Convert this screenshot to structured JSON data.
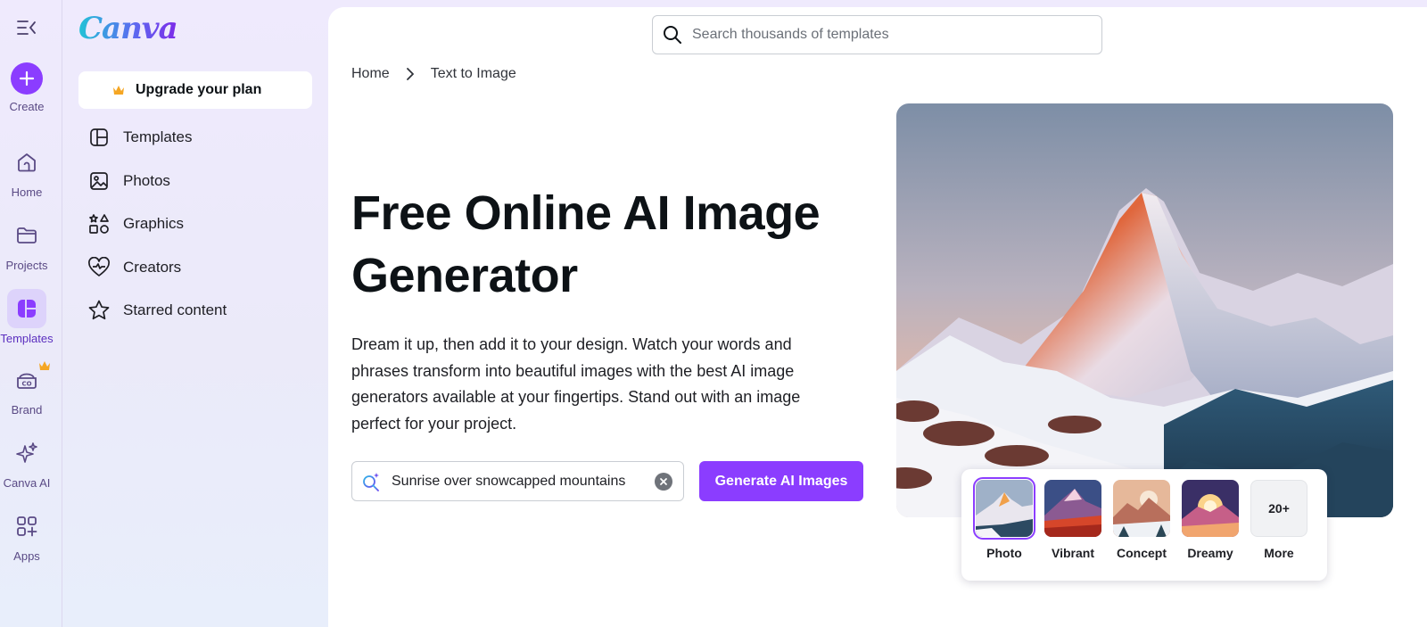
{
  "rail": {
    "create_label": "Create",
    "items": [
      {
        "label": "Home",
        "icon": "home-icon"
      },
      {
        "label": "Projects",
        "icon": "folder-icon"
      },
      {
        "label": "Templates",
        "icon": "templates-icon"
      },
      {
        "label": "Brand",
        "icon": "brand-icon"
      },
      {
        "label": "Canva AI",
        "icon": "sparkle-icon"
      },
      {
        "label": "Apps",
        "icon": "apps-icon"
      }
    ],
    "active": "Templates"
  },
  "panel": {
    "logo": "Canva",
    "upgrade_label": "Upgrade your plan",
    "items": [
      {
        "label": "Templates",
        "icon": "templates-outline-icon"
      },
      {
        "label": "Photos",
        "icon": "photo-icon"
      },
      {
        "label": "Graphics",
        "icon": "shapes-icon"
      },
      {
        "label": "Creators",
        "icon": "heart-icon"
      },
      {
        "label": "Starred content",
        "icon": "star-icon"
      }
    ]
  },
  "search": {
    "placeholder": "Search thousands of templates"
  },
  "breadcrumb": {
    "home": "Home",
    "current": "Text to Image"
  },
  "hero": {
    "title_line1": "Free Online AI Image",
    "title_line2": "Generator",
    "description": "Dream it up, then add it to your design. Watch your words and phrases transform into beautiful images with the best AI image generators available at your fingertips. Stand out with an image perfect for your project."
  },
  "prompt": {
    "value": "Sunrise over snowcapped mountains"
  },
  "generate_label": "Generate AI Images",
  "styles": {
    "items": [
      {
        "label": "Photo"
      },
      {
        "label": "Vibrant"
      },
      {
        "label": "Concept"
      },
      {
        "label": "Dreamy"
      }
    ],
    "more_count": "20+",
    "more_label": "More",
    "selected": "Photo"
  },
  "colors": {
    "accent": "#8b3dff",
    "crown": "#f5a623"
  }
}
